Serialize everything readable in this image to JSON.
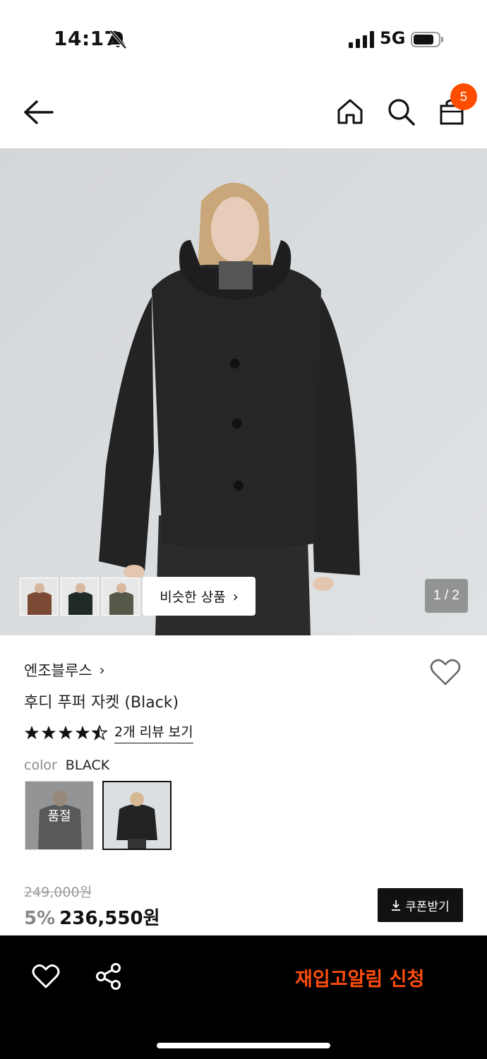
{
  "status_bar": {
    "time": "14:17",
    "network": "5G"
  },
  "nav": {
    "cart_count": "5"
  },
  "gallery": {
    "similar_products_label": "비슷한 상품",
    "page_indicator": "1 / 2"
  },
  "product": {
    "brand": "엔조블루스",
    "title": "후디 푸퍼 자켓 (Black)",
    "rating": 4.5,
    "review_link": "2개 리뷰 보기",
    "color_label": "color",
    "color_value": "BLACK",
    "soldout_label": "품절",
    "original_price": "249,000원",
    "discount": "5%",
    "sale_price": "236,550원",
    "coupon_label": "쿠폰받기"
  },
  "bottom_bar": {
    "restock_label": "재입고알림 신청"
  },
  "colors": {
    "accent": "#ff4d00",
    "restock_text": "#ff4d0d"
  }
}
